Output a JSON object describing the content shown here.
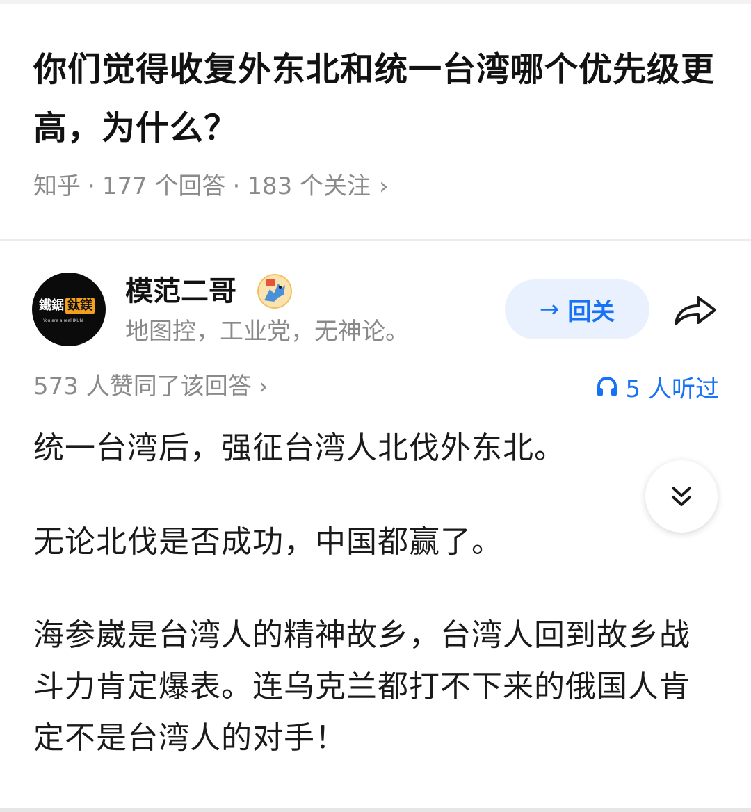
{
  "question": {
    "title": "你们觉得收复外东北和统一台湾哪个优先级更高，为什么？",
    "source": "知乎",
    "answers_count": "177 个回答",
    "followers_count": "183 个关注",
    "separator": "·",
    "chevron": "›"
  },
  "author": {
    "name": "模范二哥",
    "bio": "地图控，工业党，无神论。",
    "avatar_text_white": "鐵鋸",
    "avatar_text_orange": "鈦鎂",
    "avatar_subtext": "You are a real IKUN",
    "follow_button": {
      "arrow": "→",
      "label": "回关",
      "color": "#1772f6",
      "background": "#e8f1fd"
    },
    "share_icon": "share-arrow-icon",
    "badge_icon": "blue-dragon-badge-icon"
  },
  "answer": {
    "upvote_text": "573 人赞同了该回答",
    "chevron": "›",
    "listen_icon": "headphones-icon",
    "listen_text": "5 人听过",
    "paragraphs": [
      "统一台湾后，强征台湾人北伐外东北。",
      "无论北伐是否成功，中国都赢了。",
      "海参崴是台湾人的精神故乡，台湾人回到故乡战斗力肯定爆表。连乌克兰都打不下来的俄国人肯定不是台湾人的对手！"
    ],
    "expand_icon": "double-chevron-down-icon"
  },
  "colors": {
    "accent": "#1772f6",
    "text": "#1a1a1a",
    "muted": "#8a8a8a"
  }
}
